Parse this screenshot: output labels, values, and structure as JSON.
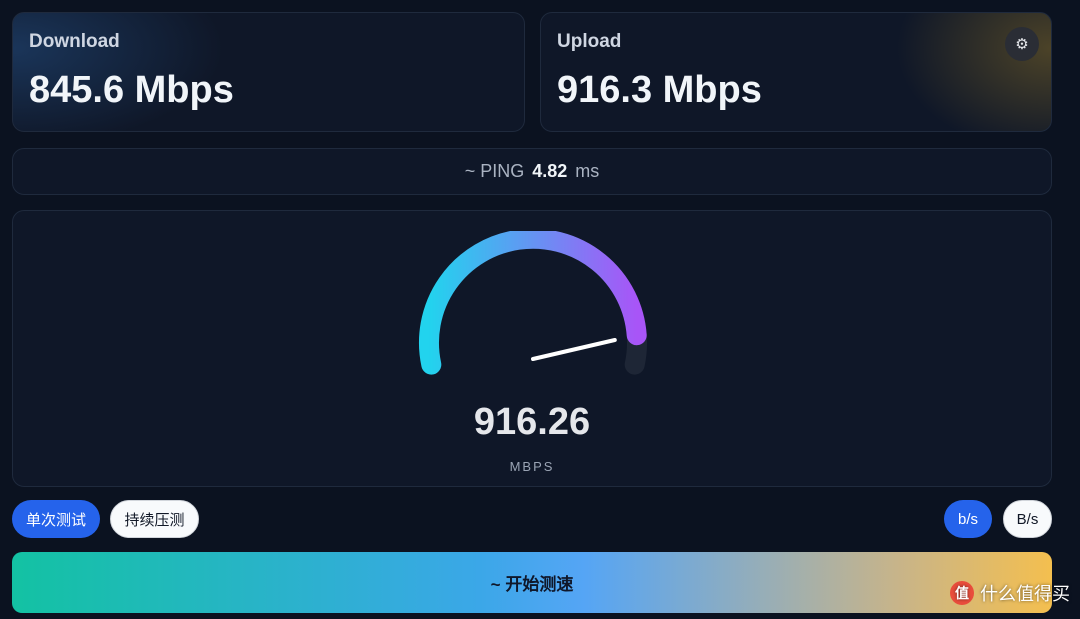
{
  "download": {
    "label": "Download",
    "value": "845.6 Mbps"
  },
  "upload": {
    "label": "Upload",
    "value": "916.3 Mbps"
  },
  "settings": {
    "icon": "gear-icon"
  },
  "ping": {
    "prefix": "~ PING",
    "value": "4.82",
    "unit": "ms"
  },
  "gauge": {
    "value": "916.26",
    "unit": "MBPS",
    "level": 0.92
  },
  "modes": {
    "single": "单次测试",
    "continuous": "持续压测"
  },
  "units": {
    "bits": "b/s",
    "bytes": "B/s"
  },
  "start": {
    "label": "~ 开始测速"
  },
  "watermark": {
    "logo": "值",
    "text": "什么值得买"
  },
  "colors": {
    "background": "#0b1220",
    "accent": "#2563eb",
    "gauge_start": "#22d3ee",
    "gauge_end": "#a855f7",
    "button_start": "#13c2a3",
    "button_end": "#f4bf4f"
  }
}
